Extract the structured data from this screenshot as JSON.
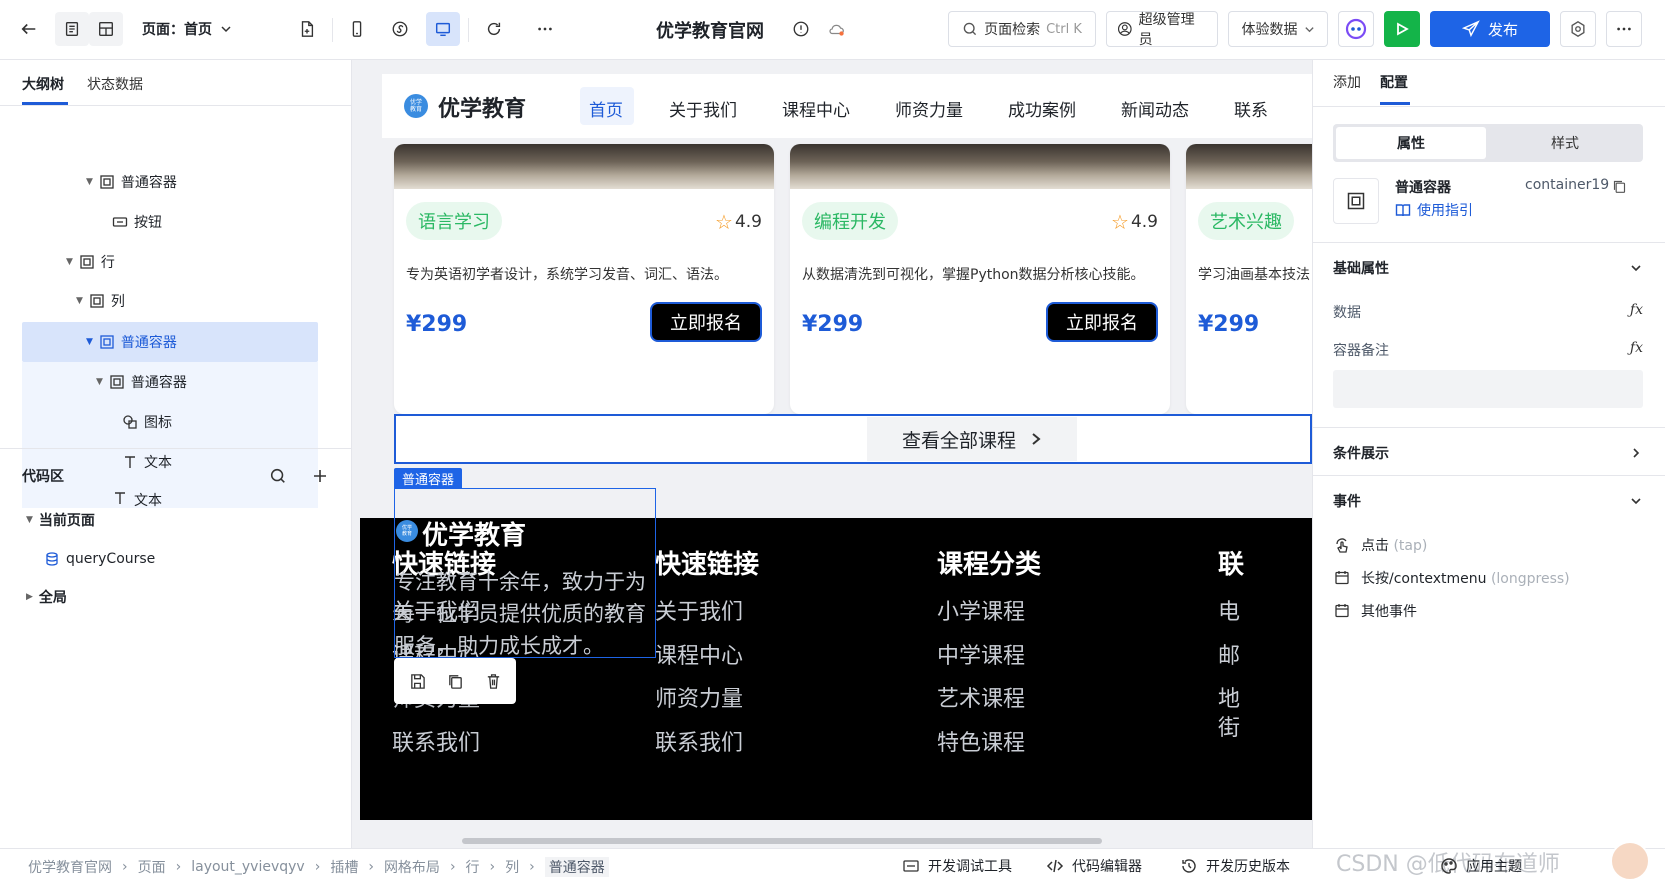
{
  "topbar": {
    "page_label": "页面：首页",
    "site_title": "优学教育官网",
    "search_label": "页面检索",
    "search_shortcut": "Ctrl K",
    "user_label": "超级管理员",
    "data_label": "体验数据",
    "publish_label": "发布"
  },
  "left": {
    "tabs": [
      "大纲树",
      "状态数据"
    ],
    "tree": [
      {
        "label": "普通容器",
        "icon": "container-icon"
      },
      {
        "label": "按钮",
        "icon": "button-icon"
      },
      {
        "label": "行",
        "icon": "container-icon"
      },
      {
        "label": "列",
        "icon": "container-icon"
      },
      {
        "label": "普通容器",
        "icon": "container-icon"
      },
      {
        "label": "普通容器",
        "icon": "container-icon"
      },
      {
        "label": "图标",
        "icon": "shapes-icon"
      },
      {
        "label": "文本",
        "icon": "text-icon"
      },
      {
        "label": "文本",
        "icon": "text-icon"
      }
    ],
    "code_title": "代码区",
    "code_tree": [
      {
        "label": "当前页面"
      },
      {
        "label": "queryCourse"
      },
      {
        "label": "全局"
      }
    ]
  },
  "canvas": {
    "brand": "优学教育",
    "logo_text": "优学\n教育",
    "nav": [
      "首页",
      "关于我们",
      "课程中心",
      "师资力量",
      "成功案例",
      "新闻动态",
      "联系"
    ],
    "cards": [
      {
        "tag": "语言学习",
        "rating": "4.9",
        "desc": "专为英语初学者设计，系统学习发音、词汇、语法。",
        "price": "¥299",
        "button": "立即报名"
      },
      {
        "tag": "编程开发",
        "rating": "4.9",
        "desc": "从数据清洗到可视化，掌握Python数据分析核心技能。",
        "price": "¥299",
        "button": "立即报名"
      },
      {
        "tag": "艺术兴趣",
        "rating": "",
        "desc": "学习油画基本技法",
        "price": "¥299",
        "button": ""
      }
    ],
    "view_all": "查看全部课程",
    "selected_badge": "普通容器",
    "footer": {
      "brand": "优学教育",
      "about": [
        "专注教育十余年，致力于为",
        "每一位学员提供优质的教育",
        "服务，助力成长成才。"
      ],
      "col2_title": "快速链接",
      "col2_links": [
        "关于我们",
        "课程中心",
        "师资力量",
        "联系我们"
      ],
      "col3_title": "课程分类",
      "col3_links": [
        "小学课程",
        "中学课程",
        "艺术课程",
        "特色课程"
      ],
      "col4_title": "联",
      "col4_links": [
        "电",
        "邮",
        "地",
        "街"
      ]
    }
  },
  "right": {
    "tabs": [
      "添加",
      "配置"
    ],
    "seg": [
      "属性",
      "样式"
    ],
    "component_name": "普通容器",
    "component_id": "container19",
    "guide": "使用指引",
    "basic_title": "基础属性",
    "props": [
      "数据",
      "容器备注"
    ],
    "cond_title": "条件展示",
    "events_title": "事件",
    "events": [
      {
        "name": "点击",
        "hint": "(tap)"
      },
      {
        "name": "长按/contextmenu",
        "hint": "(longpress)"
      },
      {
        "name": "其他事件",
        "hint": ""
      }
    ]
  },
  "bottom": {
    "crumbs": [
      "优学教育官网",
      "页面",
      "layout_yvievqyv",
      "插槽",
      "网格布局",
      "行",
      "列",
      "普通容器"
    ],
    "tools": [
      "开发调试工具",
      "代码编辑器",
      "开发历史版本"
    ],
    "theme": "应用主题",
    "watermark": "CSDN @低代码布道师"
  },
  "colors": {
    "accent": "#1e5bd7",
    "publish": "#1e64e6",
    "run": "#14b449",
    "tag_bg": "#e8f8ee",
    "tag_fg": "#2bb864"
  }
}
